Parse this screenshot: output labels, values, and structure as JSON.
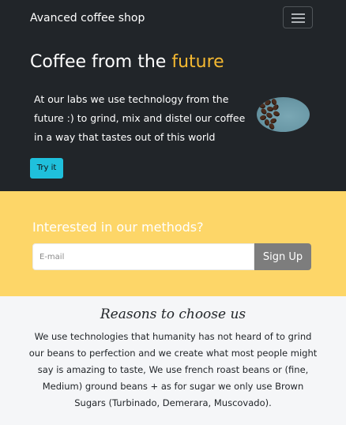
{
  "navbar": {
    "brand": "Avanced coffee shop",
    "menu_icon": "hamburger-menu-icon"
  },
  "hero": {
    "headline_main": "Coffee from the",
    "headline_accent": "future",
    "accent_color": "#f5b931",
    "lead": "At our labs we use technology from the future :) to grind, mix and distel our coffee in a way that tastes out of this world",
    "image": "coffee-beans-image",
    "cta_label": "Try it"
  },
  "signup": {
    "title": "Interested in our methods?",
    "email_placeholder": "E-mail",
    "email_value": "",
    "button_label": "Sign Up"
  },
  "reasons": {
    "title": "Reasons to choose us",
    "text": "We use technologies that humanity has not heard of to grind our beans to perfection and we create what most people might say is amazing to taste, We use french roast beans or (fine, Medium) ground beans + as for sugar we only use Brown Sugars (Turbinado, Demerara, Muscovado)."
  },
  "colors": {
    "navbar_bg": "#212529",
    "signup_bg": "#fdd668",
    "cta_bg": "#1fc0dc",
    "signup_button_bg": "#7d7d7d",
    "reasons_bg": "#f5f6f8"
  }
}
